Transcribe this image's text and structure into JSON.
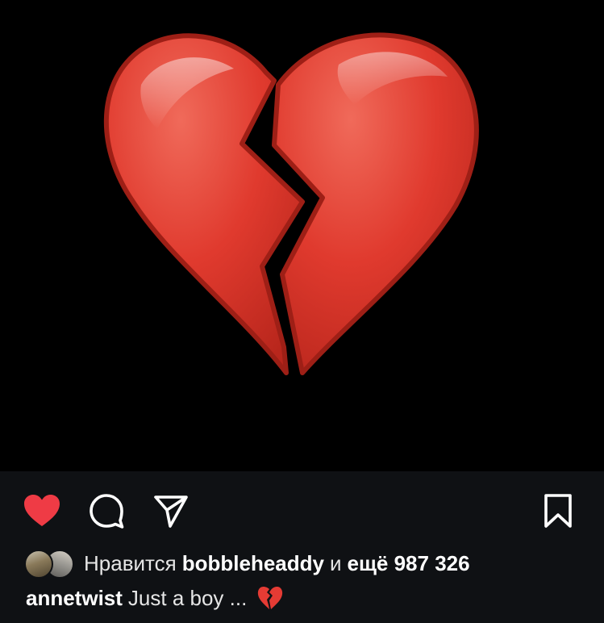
{
  "post": {
    "image": {
      "subject": "broken-heart",
      "background_color": "#000000",
      "heart_color": "#e03a2e"
    }
  },
  "actions": {
    "like": {
      "icon": "heart-filled-icon",
      "liked": true,
      "color": "#ef3b45"
    },
    "comment": {
      "icon": "comment-bubble-icon"
    },
    "share": {
      "icon": "paper-plane-icon"
    },
    "save": {
      "icon": "bookmark-icon"
    }
  },
  "likes": {
    "prefix": "Нравится",
    "user": "bobbleheaddy",
    "conjunction": "и",
    "more": "ещё 987 326"
  },
  "caption": {
    "username": "annetwist",
    "text": "Just a boy ...",
    "emoji_icon": "broken-heart-emoji-icon"
  },
  "colors": {
    "panel_background": "#0f1114",
    "text": "#ffffff",
    "like_red": "#ef3b45"
  }
}
